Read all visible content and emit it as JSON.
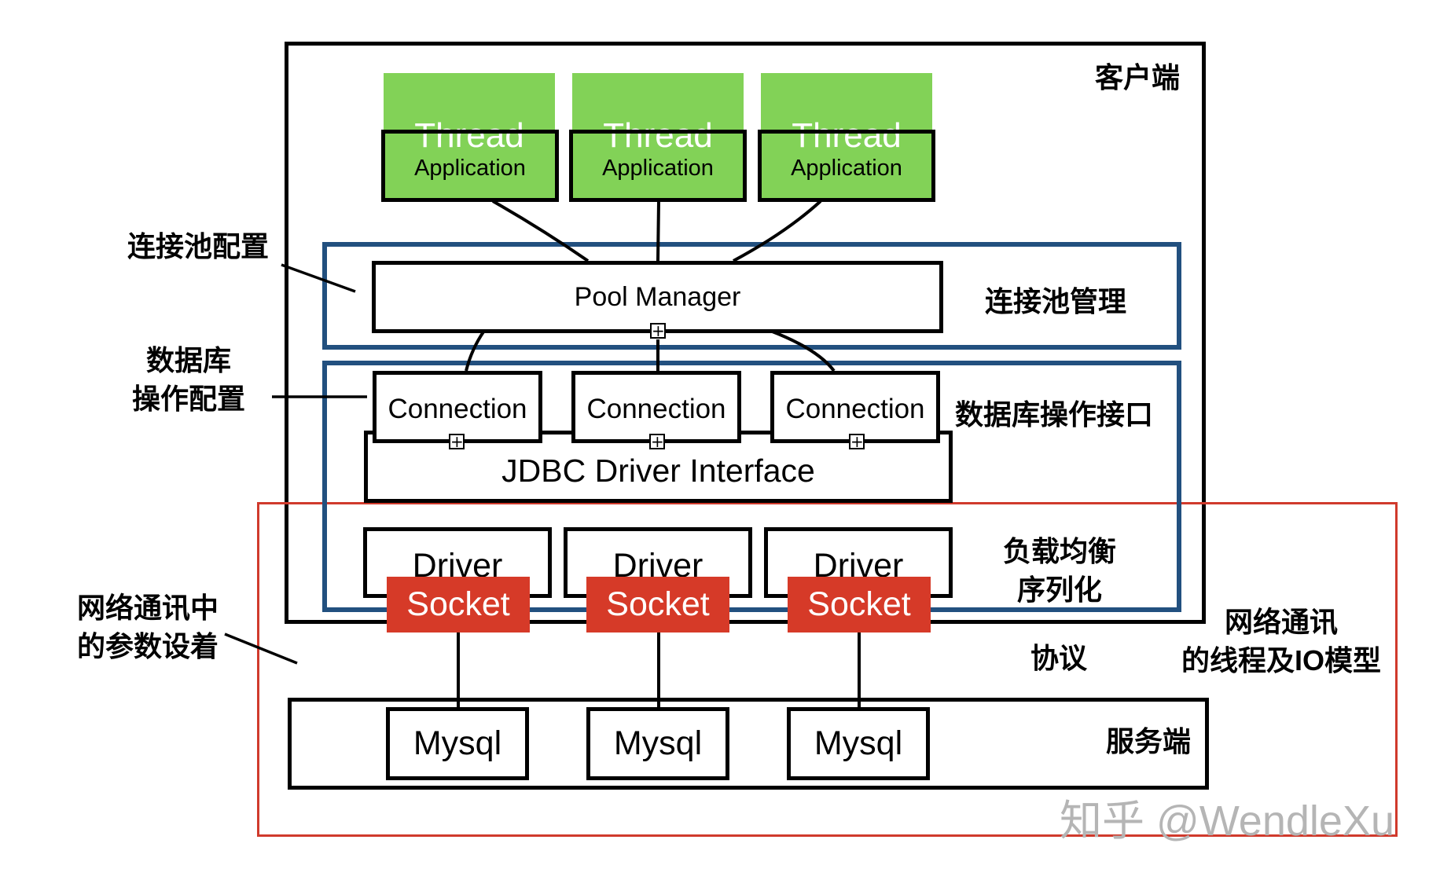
{
  "diagram": {
    "regions": {
      "client": "客户端",
      "pool_management": "连接池管理",
      "db_interface": "数据库操作接口",
      "load_balance": [
        "负载均衡",
        "序列化"
      ],
      "protocol": "协议",
      "server": "服务端",
      "network_io": [
        "网络通讯",
        "的线程及IO模型"
      ]
    },
    "annotations": {
      "pool_config": "连接池配置",
      "db_op_config": [
        "数据库",
        "操作配置"
      ],
      "network_params": [
        "网络通讯中",
        "的参数设着"
      ]
    },
    "threads": [
      {
        "top": "Thread",
        "label": "Application"
      },
      {
        "top": "Thread",
        "label": "Application"
      },
      {
        "top": "Thread",
        "label": "Application"
      }
    ],
    "pool_manager": "Pool Manager",
    "connections": [
      "Connection",
      "Connection",
      "Connection"
    ],
    "jdbc": "JDBC Driver Interface",
    "drivers": [
      "Driver",
      "Driver",
      "Driver"
    ],
    "sockets": [
      "Socket",
      "Socket",
      "Socket"
    ],
    "mysql": [
      "Mysql",
      "Mysql",
      "Mysql"
    ],
    "collapse_marker": "+",
    "colors": {
      "thread_green": "#82d257",
      "socket_red": "#d63a28",
      "blue_frame": "#22507f",
      "red_frame": "#d03a2c",
      "watermark": "#b5b5b5"
    },
    "watermark": "知乎 @WendleXu"
  }
}
